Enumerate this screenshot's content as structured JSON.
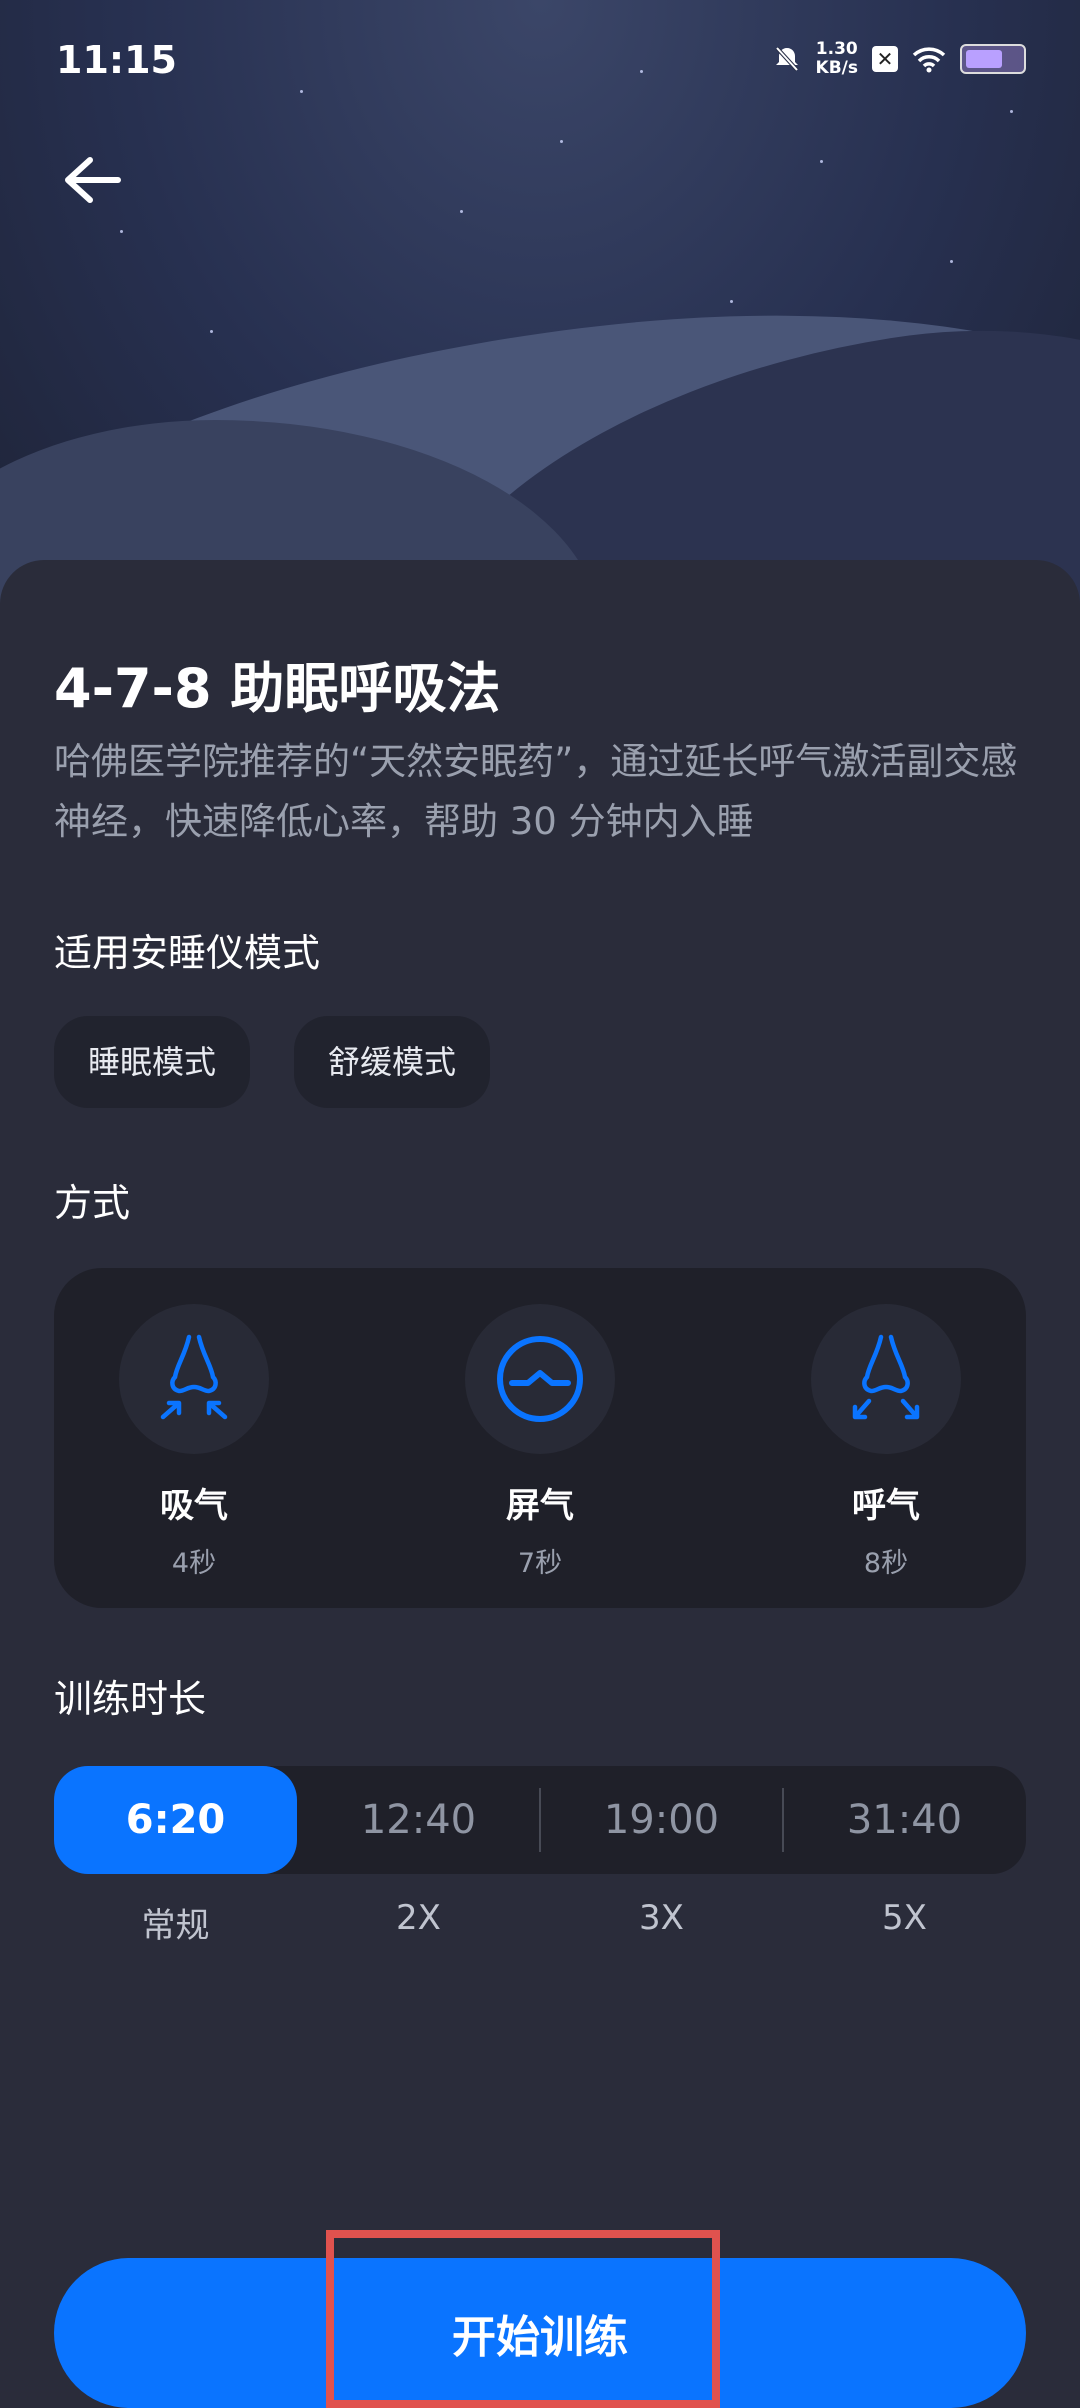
{
  "status_bar": {
    "time": "11:15",
    "net_speed_value": "1.30",
    "net_speed_unit": "KB/s"
  },
  "header": {
    "back_icon": "arrow-left-icon"
  },
  "content": {
    "title": "4-7-8 助眠呼吸法",
    "description": "哈佛医学院推荐的“天然安眠药”，通过延长呼气激活副交感神经，快速降低心率，帮助 30 分钟内入睡",
    "modes_heading": "适用安睡仪模式",
    "modes": [
      "睡眠模式",
      "舒缓模式"
    ],
    "method_heading": "方式",
    "methods": [
      {
        "name": "吸气",
        "seconds": "4秒",
        "icon": "nose-inhale-icon"
      },
      {
        "name": "屏气",
        "seconds": "7秒",
        "icon": "hold-breath-icon"
      },
      {
        "name": "呼气",
        "seconds": "8秒",
        "icon": "nose-exhale-icon"
      }
    ],
    "duration_heading": "训练时长",
    "durations": [
      {
        "time": "6:20",
        "label": "常规",
        "selected": true
      },
      {
        "time": "12:40",
        "label": "2X",
        "selected": false
      },
      {
        "time": "19:00",
        "label": "3X",
        "selected": false
      },
      {
        "time": "31:40",
        "label": "5X",
        "selected": false
      }
    ],
    "start_button": "开始训练"
  },
  "colors": {
    "accent": "#0a74ff",
    "background": "#2a2c3a",
    "highlight": "#e0524e"
  }
}
